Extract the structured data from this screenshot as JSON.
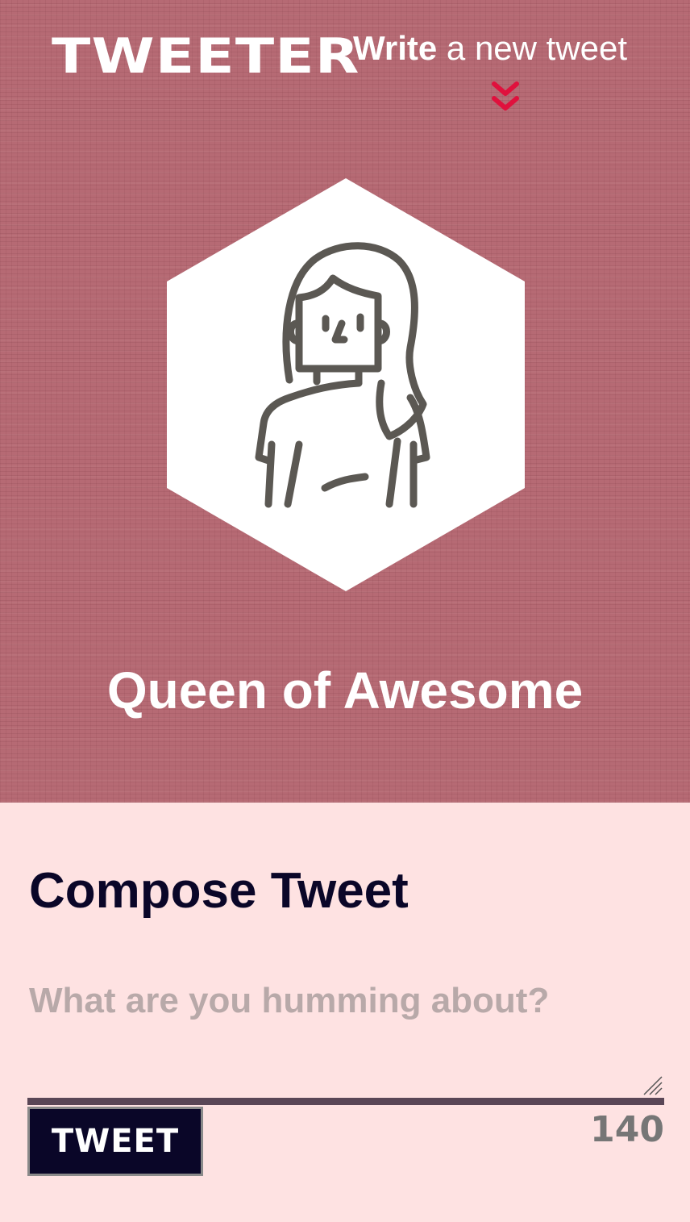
{
  "header": {
    "brand": "TWEETER",
    "nav_write_bold": "Write",
    "nav_write_rest": " a new tweet",
    "chevron_icon": "double-chevron-down-icon",
    "chevron_color": "#e0113d"
  },
  "profile": {
    "avatar_icon": "girl-avatar-icon",
    "display_name": "Queen of Awesome",
    "background_color": "#b66a74"
  },
  "compose": {
    "title": "Compose Tweet",
    "placeholder": "What are you humming about?",
    "value": "",
    "button_label": "TWEET",
    "char_count": "140",
    "background_color": "#fee2e2"
  }
}
